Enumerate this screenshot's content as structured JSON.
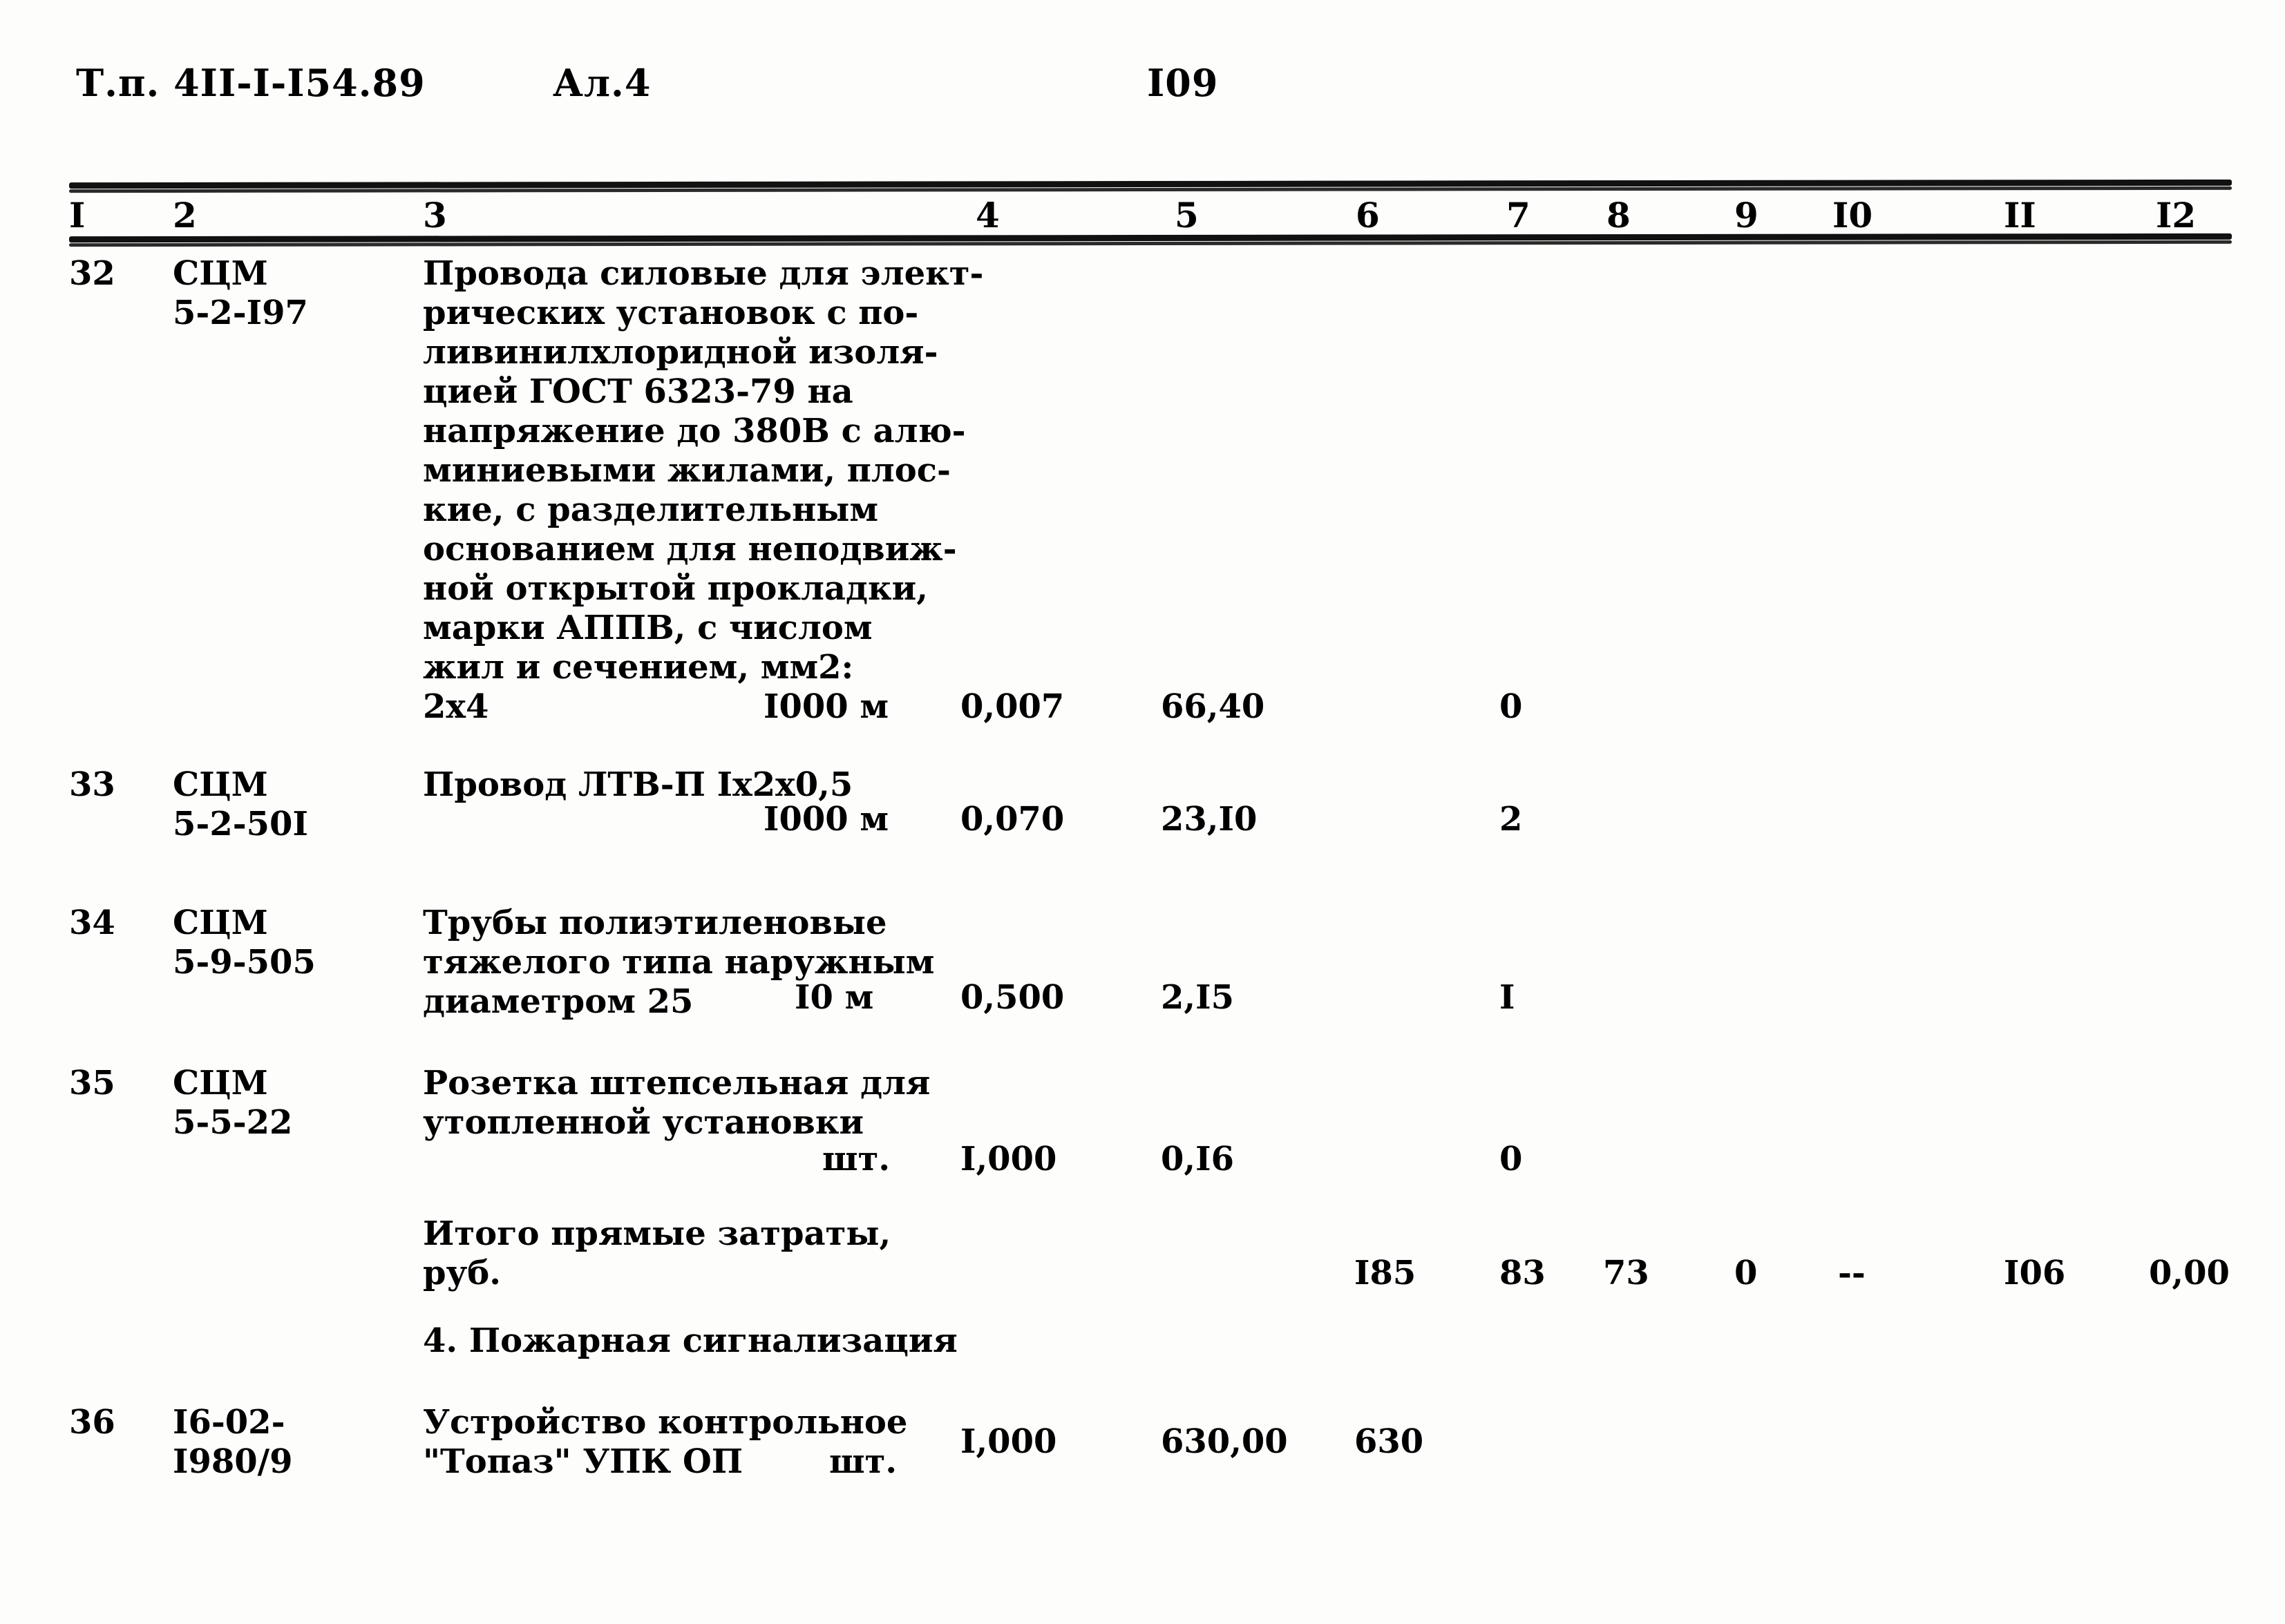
{
  "document": {
    "series_label": "Т.п. 4II-I-I54.89",
    "album_label": "Ал.4",
    "page_number": "I09"
  },
  "table": {
    "column_numbers": [
      "I",
      "2",
      "3",
      "4",
      "5",
      "6",
      "7",
      "8",
      "9",
      "I0",
      "II",
      "I2"
    ],
    "rows": [
      {
        "num": "32",
        "code": "СЦМ\n5-2-I97",
        "description": "Провода силовые для элект-\nрических установок с по-\nливинилхлоридной изоля-\nцией ГОСТ 6323-79 на\nнапряжение до 380В с алю-\nминиевыми жилами, плос-\nкие, с разделительным\nоснованием для неподвиж-\nной открытой прокладки,\nмарки АППВ, с числом\nжил и сечением, мм2:\n2х4",
        "unit": "I000 м",
        "col4": "0,007",
        "col5": "66,40",
        "col6": "",
        "col7": "0",
        "col8": "",
        "col9": "",
        "col10": "",
        "col11": "",
        "col12": ""
      },
      {
        "num": "33",
        "code": "СЦМ\n5-2-50I",
        "description": "Провод ЛТВ-П Iх2х0,5",
        "unit": "I000 м",
        "col4": "0,070",
        "col5": "23,I0",
        "col6": "",
        "col7": "2",
        "col8": "",
        "col9": "",
        "col10": "",
        "col11": "",
        "col12": ""
      },
      {
        "num": "34",
        "code": "СЦМ\n5-9-505",
        "description": "Трубы полиэтиленовые\nтяжелого типа наружным\nдиаметром 25",
        "unit": "I0 м",
        "col4": "0,500",
        "col5": "2,I5",
        "col6": "",
        "col7": "I",
        "col8": "",
        "col9": "",
        "col10": "",
        "col11": "",
        "col12": ""
      },
      {
        "num": "35",
        "code": "СЦМ\n5-5-22",
        "description": "Розетка штепсельная для\nутопленной установки",
        "unit": "шт.",
        "col4": "I,000",
        "col5": "0,I6",
        "col6": "",
        "col7": "0",
        "col8": "",
        "col9": "",
        "col10": "",
        "col11": "",
        "col12": ""
      },
      {
        "num": "36",
        "code": "I6-02-\nI980/9",
        "description": "Устройство контрольное\n\"Топаз\" УПК ОП",
        "unit": "шт.",
        "col4": "I,000",
        "col5": "630,00",
        "col6": "630",
        "col7": "",
        "col8": "",
        "col9": "",
        "col10": "",
        "col11": "",
        "col12": ""
      }
    ],
    "totals_row": {
      "label": "Итого прямые затраты,\nруб.",
      "col6": "I85",
      "col7": "83",
      "col8": "73",
      "col9": "0",
      "col10": "--",
      "col11": "I06",
      "col12": "0,00"
    },
    "section_heading": "4. Пожарная сигнализация"
  }
}
